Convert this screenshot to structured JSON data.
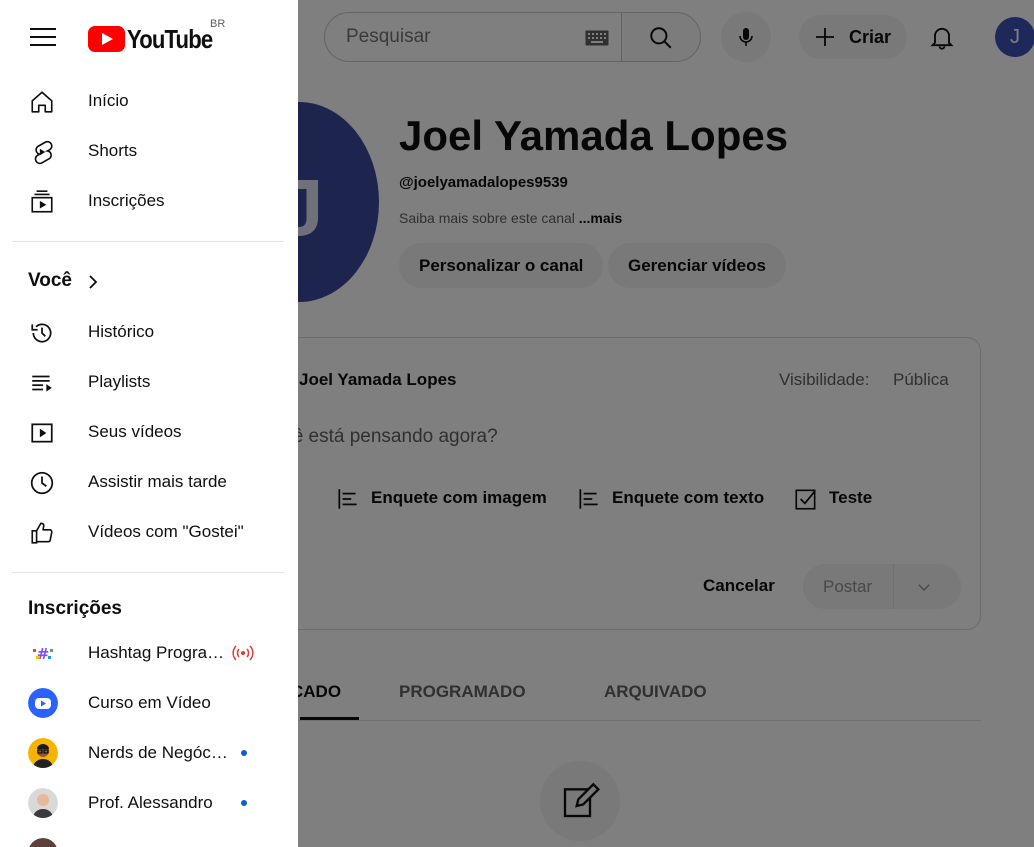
{
  "topbar": {
    "search_placeholder": "Pesquisar",
    "create_label": "Criar",
    "avatar_letter": "J"
  },
  "channel": {
    "name": "Joel Yamada Lopes",
    "handle": "@joelyamadalopes9539",
    "about": "Saiba mais sobre este canal",
    "about_more": "...mais",
    "avatar_letter": "J",
    "customize_label": "Personalizar o canal",
    "manage_label": "Gerenciar vídeos"
  },
  "post": {
    "author": "Joel Yamada Lopes",
    "visibility_label": "Visibilidade:",
    "visibility_value": "Pública",
    "placeholder": "Você está pensando agora?",
    "tool_image_poll": "Enquete com imagem",
    "tool_text_poll": "Enquete com texto",
    "tool_quiz": "Teste",
    "cancel_label": "Cancelar",
    "post_label": "Postar"
  },
  "tabs": {
    "published": "PUBLICADO",
    "scheduled": "PROGRAMADO",
    "archived": "ARQUIVADO"
  },
  "drawer": {
    "logo_text": "YouTube",
    "country": "BR",
    "nav": [
      {
        "label": "Início",
        "icon": "home-icon"
      },
      {
        "label": "Shorts",
        "icon": "shorts-icon"
      },
      {
        "label": "Inscrições",
        "icon": "subscriptions-icon"
      }
    ],
    "you_title": "Você",
    "you_items": [
      {
        "label": "Histórico",
        "icon": "history-icon"
      },
      {
        "label": "Playlists",
        "icon": "playlists-icon"
      },
      {
        "label": "Seus vídeos",
        "icon": "your-videos-icon"
      },
      {
        "label": "Assistir mais tarde",
        "icon": "watch-later-icon"
      },
      {
        "label": "Vídeos com \"Gostei\"",
        "icon": "liked-icon"
      }
    ],
    "subs_title": "Inscrições",
    "subscriptions": [
      {
        "label": "Hashtag Programação",
        "status": "live",
        "color": "#ffffff"
      },
      {
        "label": "Curso em Vídeo",
        "status": "none",
        "color": "#2962ff"
      },
      {
        "label": "Nerds de Negócios",
        "status": "new",
        "color": "#f6b400"
      },
      {
        "label": "Prof. Alessandro",
        "status": "new",
        "color": "#d9d9d9"
      }
    ]
  }
}
